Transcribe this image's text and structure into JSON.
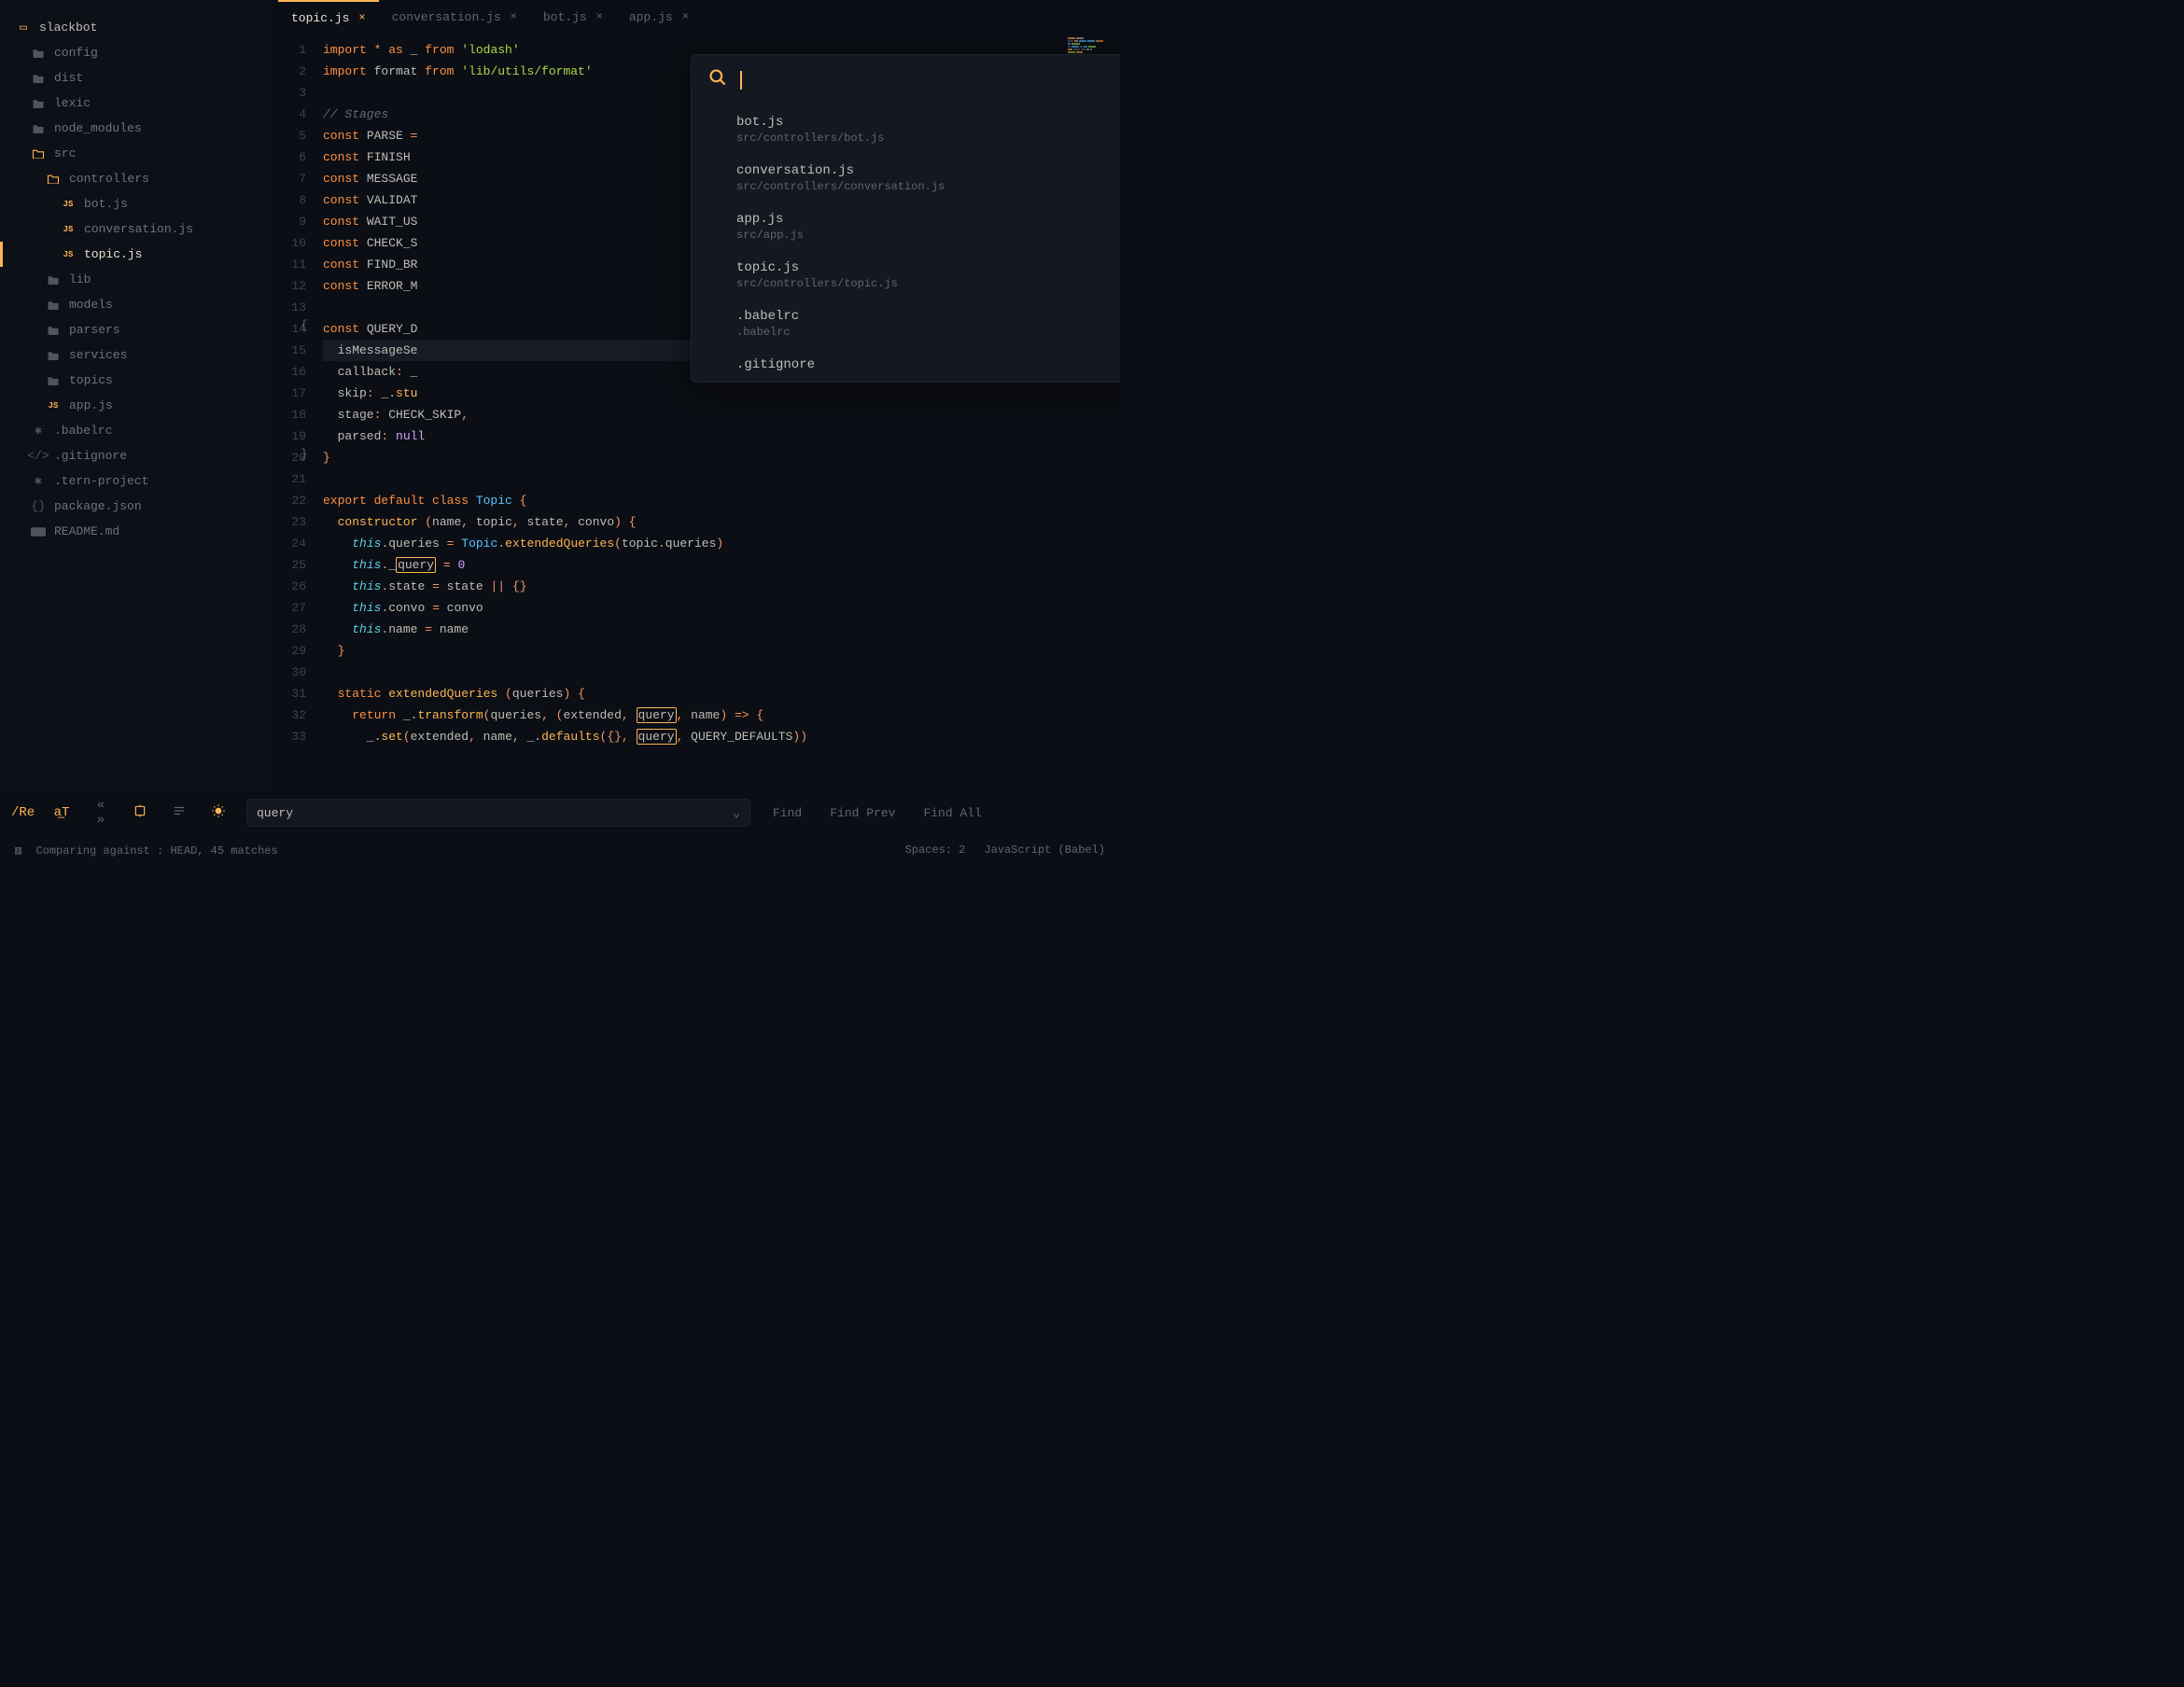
{
  "sidebar": {
    "root": "slackbot",
    "items": [
      {
        "label": "config",
        "icon": "folder",
        "indent": 1
      },
      {
        "label": "dist",
        "icon": "folder",
        "indent": 1
      },
      {
        "label": "lexic",
        "icon": "folder",
        "indent": 1
      },
      {
        "label": "node_modules",
        "icon": "folder",
        "indent": 1
      },
      {
        "label": "src",
        "icon": "folder-open",
        "indent": 1
      },
      {
        "label": "controllers",
        "icon": "folder-open",
        "indent": 2
      },
      {
        "label": "bot.js",
        "icon": "js",
        "indent": 3
      },
      {
        "label": "conversation.js",
        "icon": "js",
        "indent": 3
      },
      {
        "label": "topic.js",
        "icon": "js",
        "indent": 3,
        "active": true
      },
      {
        "label": "lib",
        "icon": "folder",
        "indent": 2
      },
      {
        "label": "models",
        "icon": "folder",
        "indent": 2
      },
      {
        "label": "parsers",
        "icon": "folder",
        "indent": 2
      },
      {
        "label": "services",
        "icon": "folder",
        "indent": 2
      },
      {
        "label": "topics",
        "icon": "folder",
        "indent": 2
      },
      {
        "label": "app.js",
        "icon": "js",
        "indent": 2
      },
      {
        "label": ".babelrc",
        "icon": "asterisk",
        "indent": 1
      },
      {
        "label": ".gitignore",
        "icon": "code",
        "indent": 1
      },
      {
        "label": ".tern-project",
        "icon": "asterisk",
        "indent": 1
      },
      {
        "label": "package.json",
        "icon": "braces",
        "indent": 1
      },
      {
        "label": "README.md",
        "icon": "md",
        "indent": 1
      }
    ]
  },
  "tabs": [
    {
      "label": "topic.js",
      "active": true
    },
    {
      "label": "conversation.js",
      "active": false
    },
    {
      "label": "bot.js",
      "active": false
    },
    {
      "label": "app.js",
      "active": false
    }
  ],
  "code": {
    "lines": [
      [
        {
          "t": "import ",
          "c": "kw"
        },
        {
          "t": "* ",
          "c": "op"
        },
        {
          "t": "as ",
          "c": "kw"
        },
        {
          "t": "_ ",
          "c": "id"
        },
        {
          "t": "from ",
          "c": "kw"
        },
        {
          "t": "'lodash'",
          "c": "str"
        }
      ],
      [
        {
          "t": "import ",
          "c": "kw"
        },
        {
          "t": "format ",
          "c": "id"
        },
        {
          "t": "from ",
          "c": "kw"
        },
        {
          "t": "'lib/utils/format'",
          "c": "str"
        }
      ],
      [],
      [
        {
          "t": "// Stages",
          "c": "cmt"
        }
      ],
      [
        {
          "t": "const ",
          "c": "kw"
        },
        {
          "t": "PARSE ",
          "c": "id"
        },
        {
          "t": "=",
          "c": "op"
        }
      ],
      [
        {
          "t": "const ",
          "c": "kw"
        },
        {
          "t": "FINISH ",
          "c": "id"
        }
      ],
      [
        {
          "t": "const ",
          "c": "kw"
        },
        {
          "t": "MESSAGE",
          "c": "id"
        }
      ],
      [
        {
          "t": "const ",
          "c": "kw"
        },
        {
          "t": "VALIDAT",
          "c": "id"
        }
      ],
      [
        {
          "t": "const ",
          "c": "kw"
        },
        {
          "t": "WAIT_US",
          "c": "id"
        }
      ],
      [
        {
          "t": "const ",
          "c": "kw"
        },
        {
          "t": "CHECK_S",
          "c": "id"
        }
      ],
      [
        {
          "t": "const ",
          "c": "kw"
        },
        {
          "t": "FIND_BR",
          "c": "id"
        }
      ],
      [
        {
          "t": "const ",
          "c": "kw"
        },
        {
          "t": "ERROR_M",
          "c": "id"
        }
      ],
      [],
      [
        {
          "t": "const ",
          "c": "kw"
        },
        {
          "t": "QUERY_D",
          "c": "id"
        }
      ],
      [
        {
          "t": "  isMessageSe",
          "c": "id"
        }
      ],
      [
        {
          "t": "  callback",
          "c": "prop"
        },
        {
          "t": ": ",
          "c": "op"
        },
        {
          "t": "_",
          "c": "id"
        }
      ],
      [
        {
          "t": "  skip",
          "c": "prop"
        },
        {
          "t": ": ",
          "c": "op"
        },
        {
          "t": "_.",
          "c": "id"
        },
        {
          "t": "stu",
          "c": "fn"
        }
      ],
      [
        {
          "t": "  stage",
          "c": "prop"
        },
        {
          "t": ": ",
          "c": "op"
        },
        {
          "t": "CHECK_SKIP",
          "c": "id"
        },
        {
          "t": ",",
          "c": "op"
        }
      ],
      [
        {
          "t": "  parsed",
          "c": "prop"
        },
        {
          "t": ": ",
          "c": "op"
        },
        {
          "t": "null",
          "c": "num"
        }
      ],
      [
        {
          "t": "}",
          "c": "op"
        }
      ],
      [],
      [
        {
          "t": "export default class ",
          "c": "kw"
        },
        {
          "t": "Topic ",
          "c": "cls"
        },
        {
          "t": "{",
          "c": "op"
        }
      ],
      [
        {
          "t": "  ",
          "c": ""
        },
        {
          "t": "constructor ",
          "c": "fn"
        },
        {
          "t": "(",
          "c": "op"
        },
        {
          "t": "name",
          "c": "id"
        },
        {
          "t": ", ",
          "c": "op"
        },
        {
          "t": "topic",
          "c": "id"
        },
        {
          "t": ", ",
          "c": "op"
        },
        {
          "t": "state",
          "c": "id"
        },
        {
          "t": ", ",
          "c": "op"
        },
        {
          "t": "convo",
          "c": "id"
        },
        {
          "t": ") {",
          "c": "op"
        }
      ],
      [
        {
          "t": "    ",
          "c": ""
        },
        {
          "t": "this",
          "c": "this"
        },
        {
          "t": ".",
          "c": "op"
        },
        {
          "t": "queries ",
          "c": "prop"
        },
        {
          "t": "= ",
          "c": "op"
        },
        {
          "t": "Topic",
          "c": "cls"
        },
        {
          "t": ".",
          "c": "op"
        },
        {
          "t": "extendedQueries",
          "c": "fn"
        },
        {
          "t": "(",
          "c": "op"
        },
        {
          "t": "topic",
          "c": "id"
        },
        {
          "t": ".",
          "c": "op"
        },
        {
          "t": "queries",
          "c": "prop"
        },
        {
          "t": ")",
          "c": "op"
        }
      ],
      [
        {
          "t": "    ",
          "c": ""
        },
        {
          "t": "this",
          "c": "this"
        },
        {
          "t": ".",
          "c": "op"
        },
        {
          "t": "_",
          "c": "prop"
        },
        {
          "t": "query",
          "c": "prop match"
        },
        {
          "t": " = ",
          "c": "op"
        },
        {
          "t": "0",
          "c": "num"
        }
      ],
      [
        {
          "t": "    ",
          "c": ""
        },
        {
          "t": "this",
          "c": "this"
        },
        {
          "t": ".",
          "c": "op"
        },
        {
          "t": "state ",
          "c": "prop"
        },
        {
          "t": "= ",
          "c": "op"
        },
        {
          "t": "state ",
          "c": "id"
        },
        {
          "t": "|| ",
          "c": "op"
        },
        {
          "t": "{}",
          "c": "op"
        }
      ],
      [
        {
          "t": "    ",
          "c": ""
        },
        {
          "t": "this",
          "c": "this"
        },
        {
          "t": ".",
          "c": "op"
        },
        {
          "t": "convo ",
          "c": "prop"
        },
        {
          "t": "= ",
          "c": "op"
        },
        {
          "t": "convo",
          "c": "id"
        }
      ],
      [
        {
          "t": "    ",
          "c": ""
        },
        {
          "t": "this",
          "c": "this"
        },
        {
          "t": ".",
          "c": "op"
        },
        {
          "t": "name ",
          "c": "prop"
        },
        {
          "t": "= ",
          "c": "op"
        },
        {
          "t": "name",
          "c": "id"
        }
      ],
      [
        {
          "t": "  }",
          "c": "op"
        }
      ],
      [],
      [
        {
          "t": "  ",
          "c": ""
        },
        {
          "t": "static ",
          "c": "kw"
        },
        {
          "t": "extendedQueries ",
          "c": "fn"
        },
        {
          "t": "(",
          "c": "op"
        },
        {
          "t": "queries",
          "c": "id"
        },
        {
          "t": ") {",
          "c": "op"
        }
      ],
      [
        {
          "t": "    ",
          "c": ""
        },
        {
          "t": "return ",
          "c": "kw"
        },
        {
          "t": "_.",
          "c": "id"
        },
        {
          "t": "transform",
          "c": "fn"
        },
        {
          "t": "(",
          "c": "op"
        },
        {
          "t": "queries",
          "c": "id"
        },
        {
          "t": ", (",
          "c": "op"
        },
        {
          "t": "extended",
          "c": "id"
        },
        {
          "t": ", ",
          "c": "op"
        },
        {
          "t": "query",
          "c": "id match"
        },
        {
          "t": ", ",
          "c": "op"
        },
        {
          "t": "name",
          "c": "id"
        },
        {
          "t": ") ",
          "c": "op"
        },
        {
          "t": "=> ",
          "c": "kw"
        },
        {
          "t": "{",
          "c": "op"
        }
      ],
      [
        {
          "t": "      _.",
          "c": "id"
        },
        {
          "t": "set",
          "c": "fn"
        },
        {
          "t": "(",
          "c": "op"
        },
        {
          "t": "extended",
          "c": "id"
        },
        {
          "t": ", ",
          "c": "op"
        },
        {
          "t": "name",
          "c": "id"
        },
        {
          "t": ", _.",
          "c": "id"
        },
        {
          "t": "defaults",
          "c": "fn"
        },
        {
          "t": "({}, ",
          "c": "op"
        },
        {
          "t": "query",
          "c": "id match"
        },
        {
          "t": ", ",
          "c": "op"
        },
        {
          "t": "QUERY_DEFAULTS",
          "c": "id"
        },
        {
          "t": "))",
          "c": "op"
        }
      ]
    ],
    "highlight_line": 15,
    "bracket_open_line": 14,
    "bracket_close_line": 20
  },
  "cmdpal": {
    "results": [
      {
        "title": "bot.js",
        "path": "src/controllers/bot.js"
      },
      {
        "title": "conversation.js",
        "path": "src/controllers/conversation.js"
      },
      {
        "title": "app.js",
        "path": "src/app.js"
      },
      {
        "title": "topic.js",
        "path": "src/controllers/topic.js"
      },
      {
        "title": ".babelrc",
        "path": ".babelrc"
      },
      {
        "title": ".gitignore",
        "path": ""
      }
    ]
  },
  "findbar": {
    "query": "query",
    "buttons": {
      "find": "Find",
      "find_prev": "Find Prev",
      "find_all": "Find All"
    }
  },
  "statusbar": {
    "left": "Comparing against : HEAD, 45 matches",
    "spaces": "Spaces: 2",
    "lang": "JavaScript (Babel)"
  }
}
